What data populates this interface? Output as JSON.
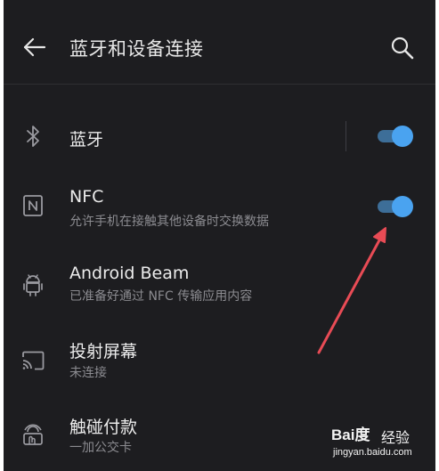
{
  "header": {
    "title": "蓝牙和设备连接",
    "back_icon": "arrow-left-icon",
    "search_icon": "search-icon"
  },
  "settings": [
    {
      "id": "bluetooth",
      "title": "蓝牙",
      "subtitle": "",
      "icon": "bluetooth-icon",
      "toggle": true,
      "toggle_on": true
    },
    {
      "id": "nfc",
      "title": "NFC",
      "subtitle": "允许手机在接触其他设备时交换数据",
      "icon": "nfc-icon",
      "toggle": true,
      "toggle_on": true
    },
    {
      "id": "android-beam",
      "title": "Android Beam",
      "subtitle": "已准备好通过 NFC 传输应用内容",
      "icon": "android-icon",
      "toggle": false
    },
    {
      "id": "cast",
      "title": "投射屏幕",
      "subtitle": "未连接",
      "icon": "cast-icon",
      "toggle": false
    },
    {
      "id": "tap-pay",
      "title": "触碰付款",
      "subtitle": "一加公交卡",
      "icon": "tap-pay-icon",
      "toggle": false
    }
  ],
  "watermark": {
    "logo": "Bai度",
    "label": "经验",
    "url": "jingyan.baidu.com"
  },
  "colors": {
    "background": "#1d1d20",
    "accent": "#4aa3f0",
    "annotation_arrow": "#e84b55"
  }
}
